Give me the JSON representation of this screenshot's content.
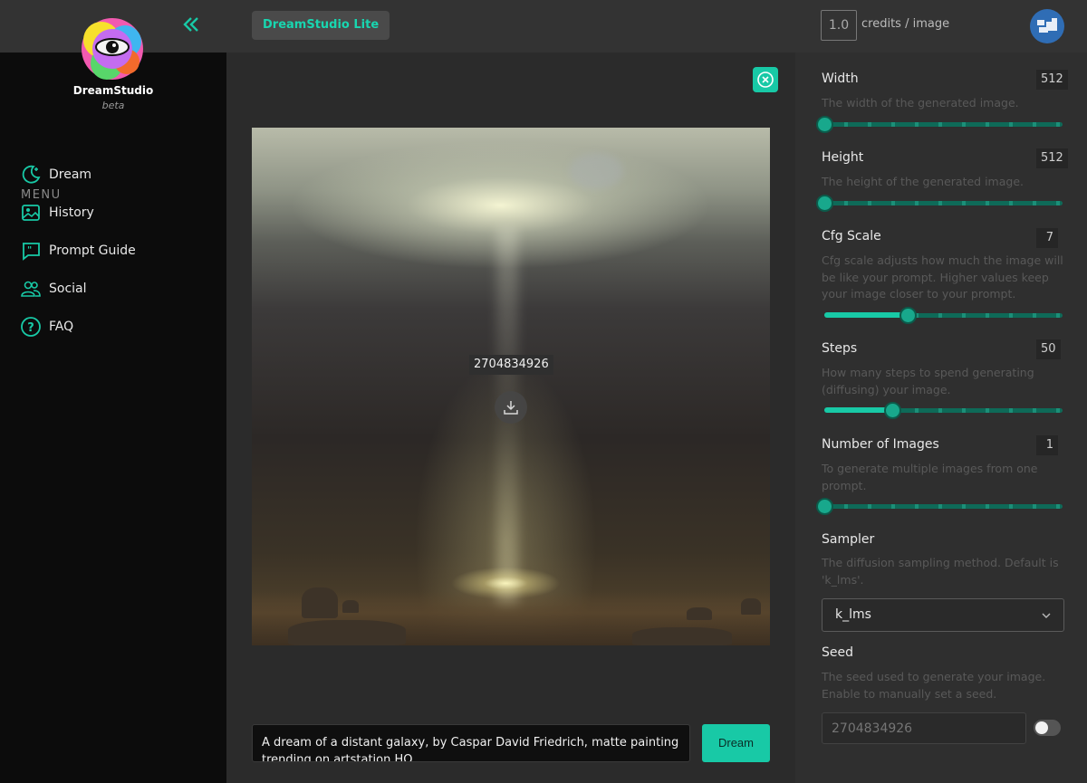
{
  "app": {
    "name": "DreamStudio",
    "subtitle": "beta",
    "brand_chip": "DreamStudio Lite"
  },
  "topbar": {
    "credits_value": "1.0",
    "credits_label": "credits / image"
  },
  "sidebar": {
    "menu_heading": "MENU",
    "items": [
      {
        "label": "Dream",
        "icon": "moon-stars-icon"
      },
      {
        "label": "History",
        "icon": "image-gallery-icon"
      },
      {
        "label": "Prompt Guide",
        "icon": "quote-bubble-icon"
      },
      {
        "label": "Social",
        "icon": "users-icon"
      },
      {
        "label": "FAQ",
        "icon": "question-circle-icon"
      }
    ]
  },
  "main": {
    "image_seed": "2704834926",
    "prompt": "A dream of a distant galaxy, by Caspar David Friedrich, matte painting trending on artstation HQ",
    "dream_button": "Dream"
  },
  "settings": {
    "width": {
      "label": "Width",
      "value": "512",
      "desc": "The width of the generated image.",
      "fraction": 0.0
    },
    "height": {
      "label": "Height",
      "value": "512",
      "desc": "The height of the generated image.",
      "fraction": 0.0
    },
    "cfg_scale": {
      "label": "Cfg Scale",
      "value": "7",
      "desc": "Cfg scale adjusts how much the image will be like your prompt. Higher values keep your image closer to your prompt.",
      "fraction": 0.35
    },
    "steps": {
      "label": "Steps",
      "value": "50",
      "desc": "How many steps to spend generating (diffusing) your image.",
      "fraction": 0.285
    },
    "num_images": {
      "label": "Number of Images",
      "value": "1",
      "desc": "To generate multiple images from one prompt.",
      "fraction": 0.0
    },
    "sampler": {
      "label": "Sampler",
      "desc": "The diffusion sampling method. Default is 'k_lms'.",
      "selected": "k_lms"
    },
    "seed": {
      "label": "Seed",
      "desc": "The seed used to generate your image. Enable to manually set a seed.",
      "placeholder": "2704834926",
      "enabled": false
    }
  },
  "colors": {
    "accent": "#18c9a6",
    "sidebar_bg": "#0c0c0c",
    "panel_bg": "#2f2f2f"
  }
}
